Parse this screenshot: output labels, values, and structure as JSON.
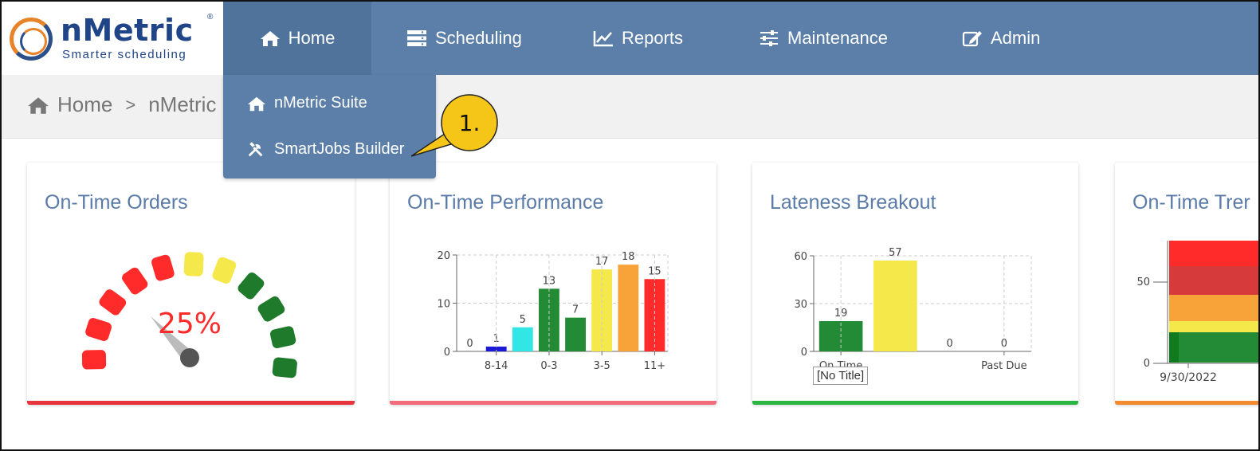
{
  "logo": {
    "name": "nMetric",
    "tagline": "Smarter scheduling",
    "reg_mark": "®"
  },
  "nav": {
    "items": [
      {
        "label": "Home",
        "icon": "home-icon"
      },
      {
        "label": "Scheduling",
        "icon": "server-icon"
      },
      {
        "label": "Reports",
        "icon": "line-chart-icon"
      },
      {
        "label": "Maintenance",
        "icon": "sliders-icon"
      },
      {
        "label": "Admin",
        "icon": "edit-icon"
      }
    ]
  },
  "breadcrumb": {
    "home": "Home",
    "separator": ">",
    "current": "nMetric"
  },
  "dropdown": {
    "items": [
      {
        "label": "nMetric Suite",
        "icon": "home-icon"
      },
      {
        "label": "SmartJobs Builder",
        "icon": "tools-icon"
      }
    ]
  },
  "callout": {
    "text": "1.",
    "color": "#f5c518"
  },
  "colors": {
    "nav_bg": "#5b7fa8",
    "title": "#5a7aa8",
    "red": "#ff2a2a",
    "yellow": "#f5e84a",
    "green": "#238b35"
  },
  "cards": {
    "gauge": {
      "title": "On-Time Orders",
      "value": "25%",
      "bottom_color": "#e8353d"
    },
    "performance": {
      "title": "On-Time Performance",
      "bottom_color": "#f26b7a"
    },
    "lateness": {
      "title": "Lateness Breakout",
      "bottom_color": "#2bb543",
      "tooltip": "[No Title]"
    },
    "trend": {
      "title": "On-Time Trer",
      "bottom_color": "#f28a30"
    }
  },
  "chart_data": [
    {
      "type": "bar",
      "chart": "on-time-performance",
      "categories": [
        "",
        "8-14",
        "",
        "0-3",
        "",
        "3-5",
        "",
        "11+"
      ],
      "values": [
        0,
        1,
        5,
        13,
        7,
        17,
        18,
        15
      ],
      "colors": [
        "#1a1ad6",
        "#1a1ad6",
        "#33e6e6",
        "#238b35",
        "#238b35",
        "#f5e84a",
        "#f7a33a",
        "#ff2a2a"
      ],
      "yticks": [
        "0",
        "10",
        "20"
      ],
      "ylim": [
        0,
        20
      ]
    },
    {
      "type": "bar",
      "chart": "lateness-breakout",
      "categories": [
        "On Time",
        "",
        "",
        "Past Due"
      ],
      "values": [
        19,
        57,
        0,
        0
      ],
      "colors": [
        "#238b35",
        "#f5e84a",
        "#f7a33a",
        "#ff2a2a"
      ],
      "yticks": [
        "0",
        "30",
        "60"
      ],
      "ylim": [
        0,
        60
      ]
    },
    {
      "type": "area",
      "chart": "on-time-trend",
      "x": [
        "9/30/2022"
      ],
      "yticks": [
        "0",
        "50"
      ]
    }
  ]
}
